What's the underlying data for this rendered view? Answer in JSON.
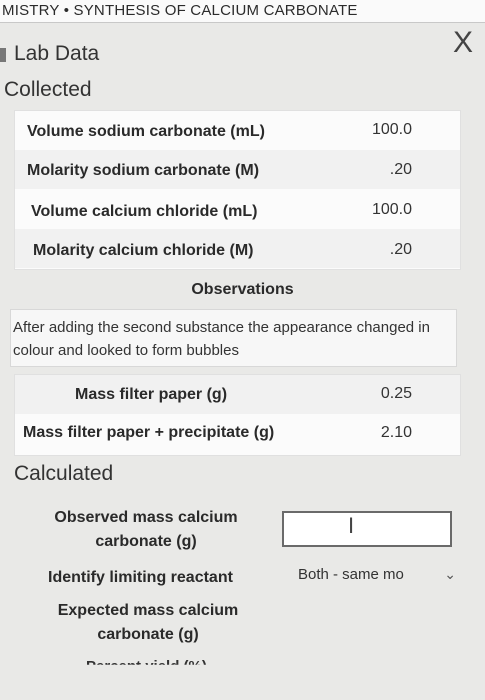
{
  "app_title": "MISTRY • SYNTHESIS OF CALCIUM CARBONATE",
  "close_icon_glyph": "X",
  "lab_data_heading": "Lab Data",
  "collected_heading": "Collected",
  "collected": [
    {
      "label": "Volume sodium carbonate (mL)",
      "value": "100.0"
    },
    {
      "label": "Molarity sodium carbonate (M)",
      "value": ".20"
    },
    {
      "label": "Volume calcium chloride (mL)",
      "value": "100.0"
    },
    {
      "label": "Molarity calcium chloride (M)",
      "value": ".20"
    }
  ],
  "observations": {
    "title": "Observations",
    "text": "After adding the second substance the appearance changed in colour and looked to form bubbles"
  },
  "masses": [
    {
      "label": "Mass filter paper (g)",
      "value": "0.25"
    },
    {
      "label": "Mass filter paper + precipitate (g)",
      "value": "2.10"
    }
  ],
  "calculated_heading": "Calculated",
  "calculated": {
    "observed_mass_line1": "Observed mass calcium",
    "observed_mass_line2": "carbonate (g)",
    "limiting_reactant_label": "Identify limiting reactant",
    "limiting_reactant_value": "Both - same mo",
    "expected_mass_line1": "Expected mass calcium",
    "expected_mass_line2": "carbonate (g)",
    "percent_yield_label": "Percent yield (%)"
  },
  "icons": {
    "close": "close-icon",
    "text_cursor": "text-cursor-icon",
    "dropdown": "chevron-down-icon"
  }
}
